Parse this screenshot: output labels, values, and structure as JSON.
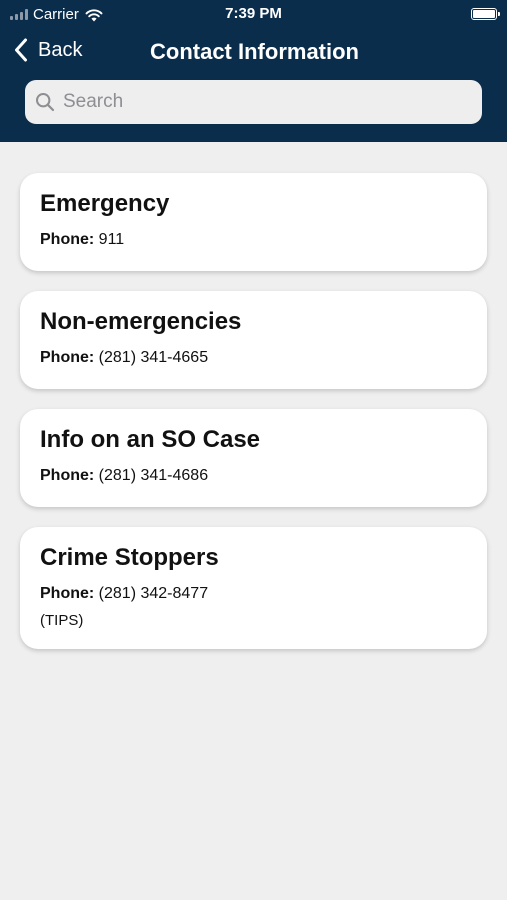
{
  "status_bar": {
    "carrier": "Carrier",
    "time": "7:39 PM"
  },
  "nav": {
    "back_label": "Back",
    "title": "Contact Information"
  },
  "search": {
    "placeholder": "Search"
  },
  "phone_label": "Phone:",
  "contacts": [
    {
      "title": "Emergency",
      "phone": "911"
    },
    {
      "title": "Non-emergencies",
      "phone": "(281) 341-4665"
    },
    {
      "title": "Info on an SO Case",
      "phone": "(281) 341-4686"
    },
    {
      "title": "Crime Stoppers",
      "phone": "(281) 342-8477",
      "note": "(TIPS)"
    }
  ],
  "colors": {
    "header_bg": "#0b2d4c",
    "page_bg": "#efefef",
    "card_bg": "#ffffff"
  }
}
